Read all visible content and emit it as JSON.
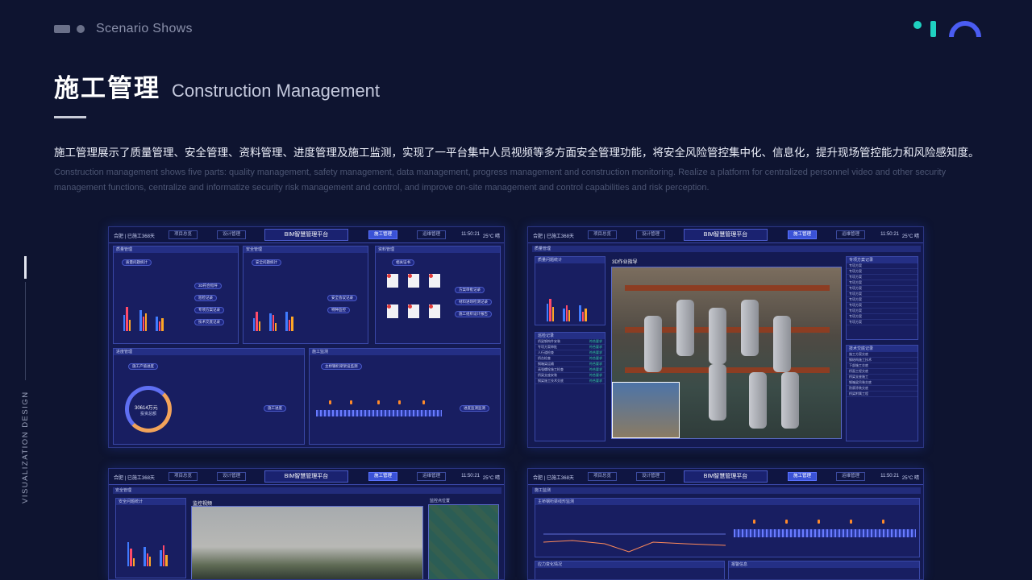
{
  "header": {
    "section_label": "Scenario Shows",
    "title_cn": "施工管理",
    "title_en": "Construction Management"
  },
  "description": {
    "cn": "施工管理展示了质量管理、安全管理、资料管理、进度管理及施工监测，实现了一平台集中人员视频等多方面安全管理功能，将安全风险管控集中化、信息化，提升现场管控能力和风险感知度。",
    "en": "Construction management shows five parts: quality management, safety management, data management, progress management and construction monitoring. Realize a platform for centralized personnel video and other security management functions, centralize and informatize security risk management and control, and improve on-site management and control capabilities and risk perception."
  },
  "side_label": "VISUALIZATION DESIGN",
  "dashboard": {
    "location": "合肥 | 已施工368天",
    "platform_title": "BIM智慧管理平台",
    "time": "11:50:21",
    "weather": "25°C 晴",
    "nav": [
      "项目总览",
      "设计管理",
      "施工管理",
      "运维管理"
    ]
  },
  "card1": {
    "quality_title": "质量管理",
    "quality_stat": "质量问题统计",
    "quality_buttons": [
      "3D符合指导",
      "巡检记录",
      "专项方案记录",
      "技术交底记录"
    ],
    "safety_title": "安全管理",
    "safety_stat": "安全问题统计",
    "safety_buttons": [
      "安全会议记录",
      "特种监控"
    ],
    "data_title": "资料管理",
    "data_sub": "相关证书",
    "data_buttons": [
      "方案审批记录",
      "材料进场检测记录",
      "施工组织设计报告"
    ],
    "progress_title": "进度管理",
    "progress_sub": "施工产值进度",
    "progress_value": "30614万元",
    "progress_label": "投资总额",
    "progress_btn": "施工进度",
    "monitor_title": "施工监测",
    "monitor_sub": "主桥钢桁梁架设监测",
    "monitor_btn": "进度监测监测"
  },
  "card2": {
    "quality_title": "质量管理",
    "stat_title": "质量问题统计",
    "records_title": "巡检记录",
    "video_title": "3D作业指导",
    "plans_title": "专项方案记录",
    "tech_title": "技术交底记录",
    "records": [
      {
        "name": "桥梁钢构件安装",
        "status": "符合要求"
      },
      {
        "name": "专项方案审批",
        "status": "符合要求"
      },
      {
        "name": "人行道检查",
        "status": "符合要求"
      },
      {
        "name": "桥台检查",
        "status": "符合要求"
      },
      {
        "name": "钢箱梁运输",
        "status": "符合要求"
      },
      {
        "name": "高强螺栓施工检查",
        "status": "符合要求"
      },
      {
        "name": "桥梁支座安装",
        "status": "符合要求"
      },
      {
        "name": "钢梁施工技术交底",
        "status": "符合要求"
      }
    ],
    "plans": [
      "专项方案",
      "专项方案",
      "专项方案",
      "专项方案",
      "专项方案",
      "专项方案",
      "专项方案",
      "专项方案",
      "专项方案",
      "专项方案",
      "专项方案"
    ],
    "techs": [
      "施工方案交底",
      "钢结构施工技术",
      "下部施工交底",
      "桥面工程交底",
      "桥梁支座施工",
      "钢箱梁吊装交底",
      "防腐涂装交底",
      "桥梁附属工程"
    ]
  },
  "card3": {
    "safety_title": "安全管理",
    "stat_title": "安全问题统计",
    "video_title": "监控视频",
    "map_title": "监控点位置"
  },
  "card4": {
    "monitor_title": "施工监测",
    "chart_title": "主桥钢桁梁线形监测",
    "stress_title": "应力变化情况",
    "alarm_title": "报警信息"
  }
}
